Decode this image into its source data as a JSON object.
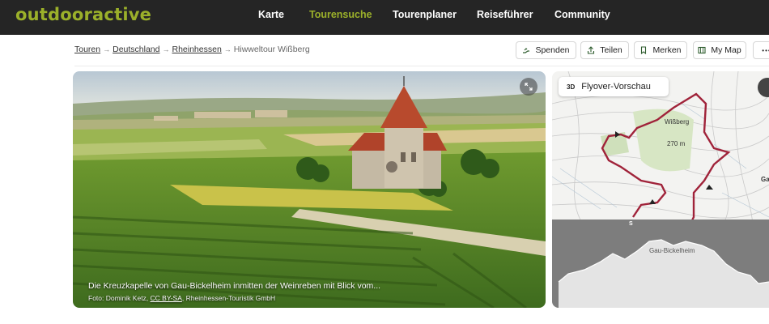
{
  "logo": "outdooractive",
  "nav": [
    "Karte",
    "Tourensuche",
    "Tourenplaner",
    "Reiseführer",
    "Community"
  ],
  "nav_active": "Tourensuche",
  "breadcrumb": {
    "items": [
      "Touren",
      "Deutschland",
      "Rheinhessen"
    ],
    "current": "Hiwweltour Wißberg"
  },
  "actions": {
    "spenden": "Spenden",
    "teilen": "Teilen",
    "merken": "Merken",
    "mymap": "My Map",
    "more": "•••"
  },
  "photo": {
    "caption": "Die Kreuzkapelle von Gau-Bickelheim inmitten der Weinreben mit Blick vom...",
    "credit_prefix": "Foto: Dominik Ketz, ",
    "credit_license": "CC BY-SA",
    "credit_suffix": ", Rheinhessen-Touristik GmbH"
  },
  "map": {
    "flyover_label": "Flyover-Vorschau",
    "flyover_badge": "3D",
    "labels": {
      "peak": "Wißberg",
      "elevation": "270 m",
      "town_right": "Ga",
      "profile_label": "Gau-Bickelheim",
      "start_marker": "S"
    }
  },
  "colors": {
    "brand": "#9bb02a",
    "topbar": "#252525",
    "route": "#a0233a"
  }
}
